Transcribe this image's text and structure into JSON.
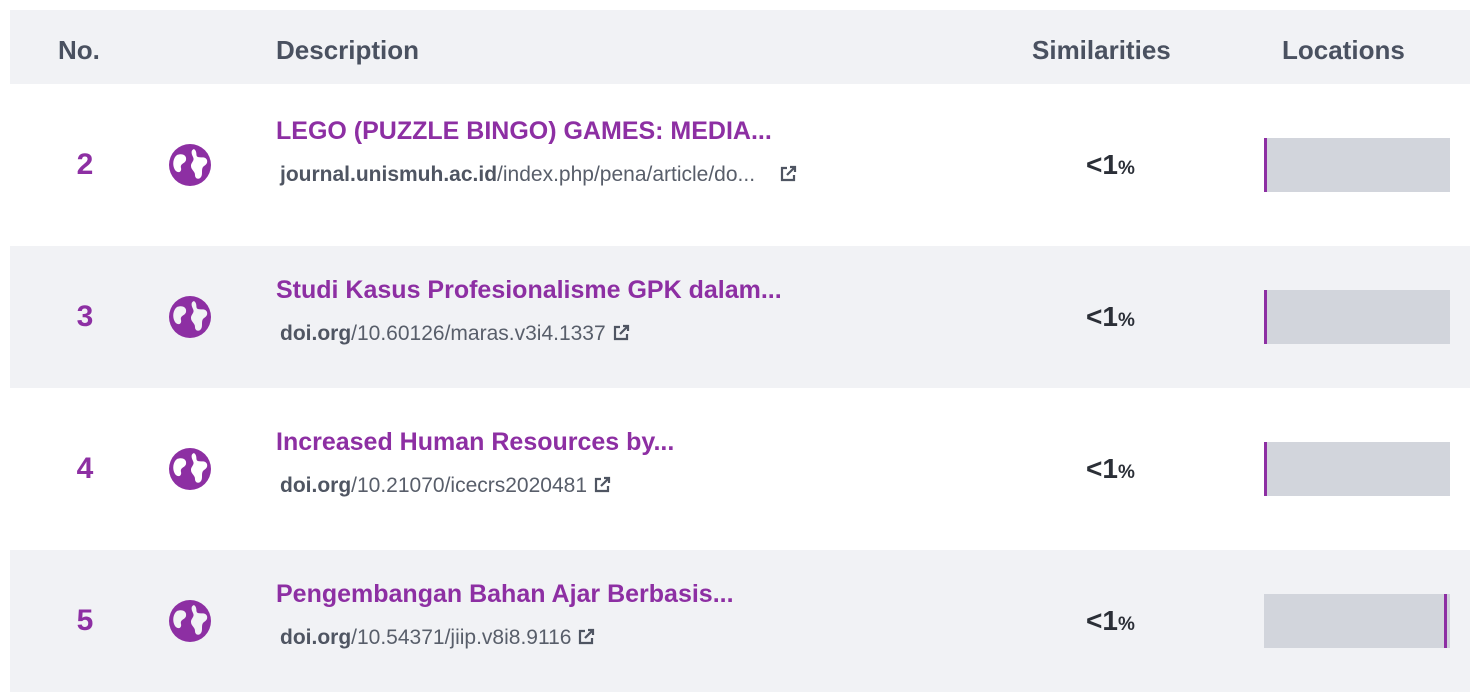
{
  "header": {
    "no": "No.",
    "description": "Description",
    "similarities": "Similarities",
    "locations": "Locations"
  },
  "rows": [
    {
      "number": "2",
      "title": "LEGO (PUZZLE BINGO) GAMES: MEDIA...",
      "url_domain": "journal.unismuh.ac.id",
      "url_path": "/index.php/pena/article/do...",
      "similarity": "<1",
      "similarity_unit": "%",
      "location_marker": 0.0
    },
    {
      "number": "3",
      "title": "Studi Kasus Profesionalisme GPK dalam...",
      "url_domain": "doi.org",
      "url_path": "/10.60126/maras.v3i4.1337",
      "similarity": "<1",
      "similarity_unit": "%",
      "location_marker": 0.0
    },
    {
      "number": "4",
      "title": "Increased Human Resources by...",
      "url_domain": "doi.org",
      "url_path": "/10.21070/icecrs2020481",
      "similarity": "<1",
      "similarity_unit": "%",
      "location_marker": 0.0
    },
    {
      "number": "5",
      "title": "Pengembangan Bahan Ajar Berbasis...",
      "url_domain": "doi.org",
      "url_path": "/10.54371/jiip.v8i8.9116",
      "similarity": "<1",
      "similarity_unit": "%",
      "location_marker": 0.985
    }
  ],
  "icons": {
    "source_type": "globe-icon",
    "link": "external-link-icon"
  },
  "colors": {
    "accent": "#8d2fa3",
    "header_bg": "#f1f2f5",
    "location_bar": "#d2d5dc",
    "text_dark": "#2b2f37",
    "text_muted": "#585e6a"
  }
}
